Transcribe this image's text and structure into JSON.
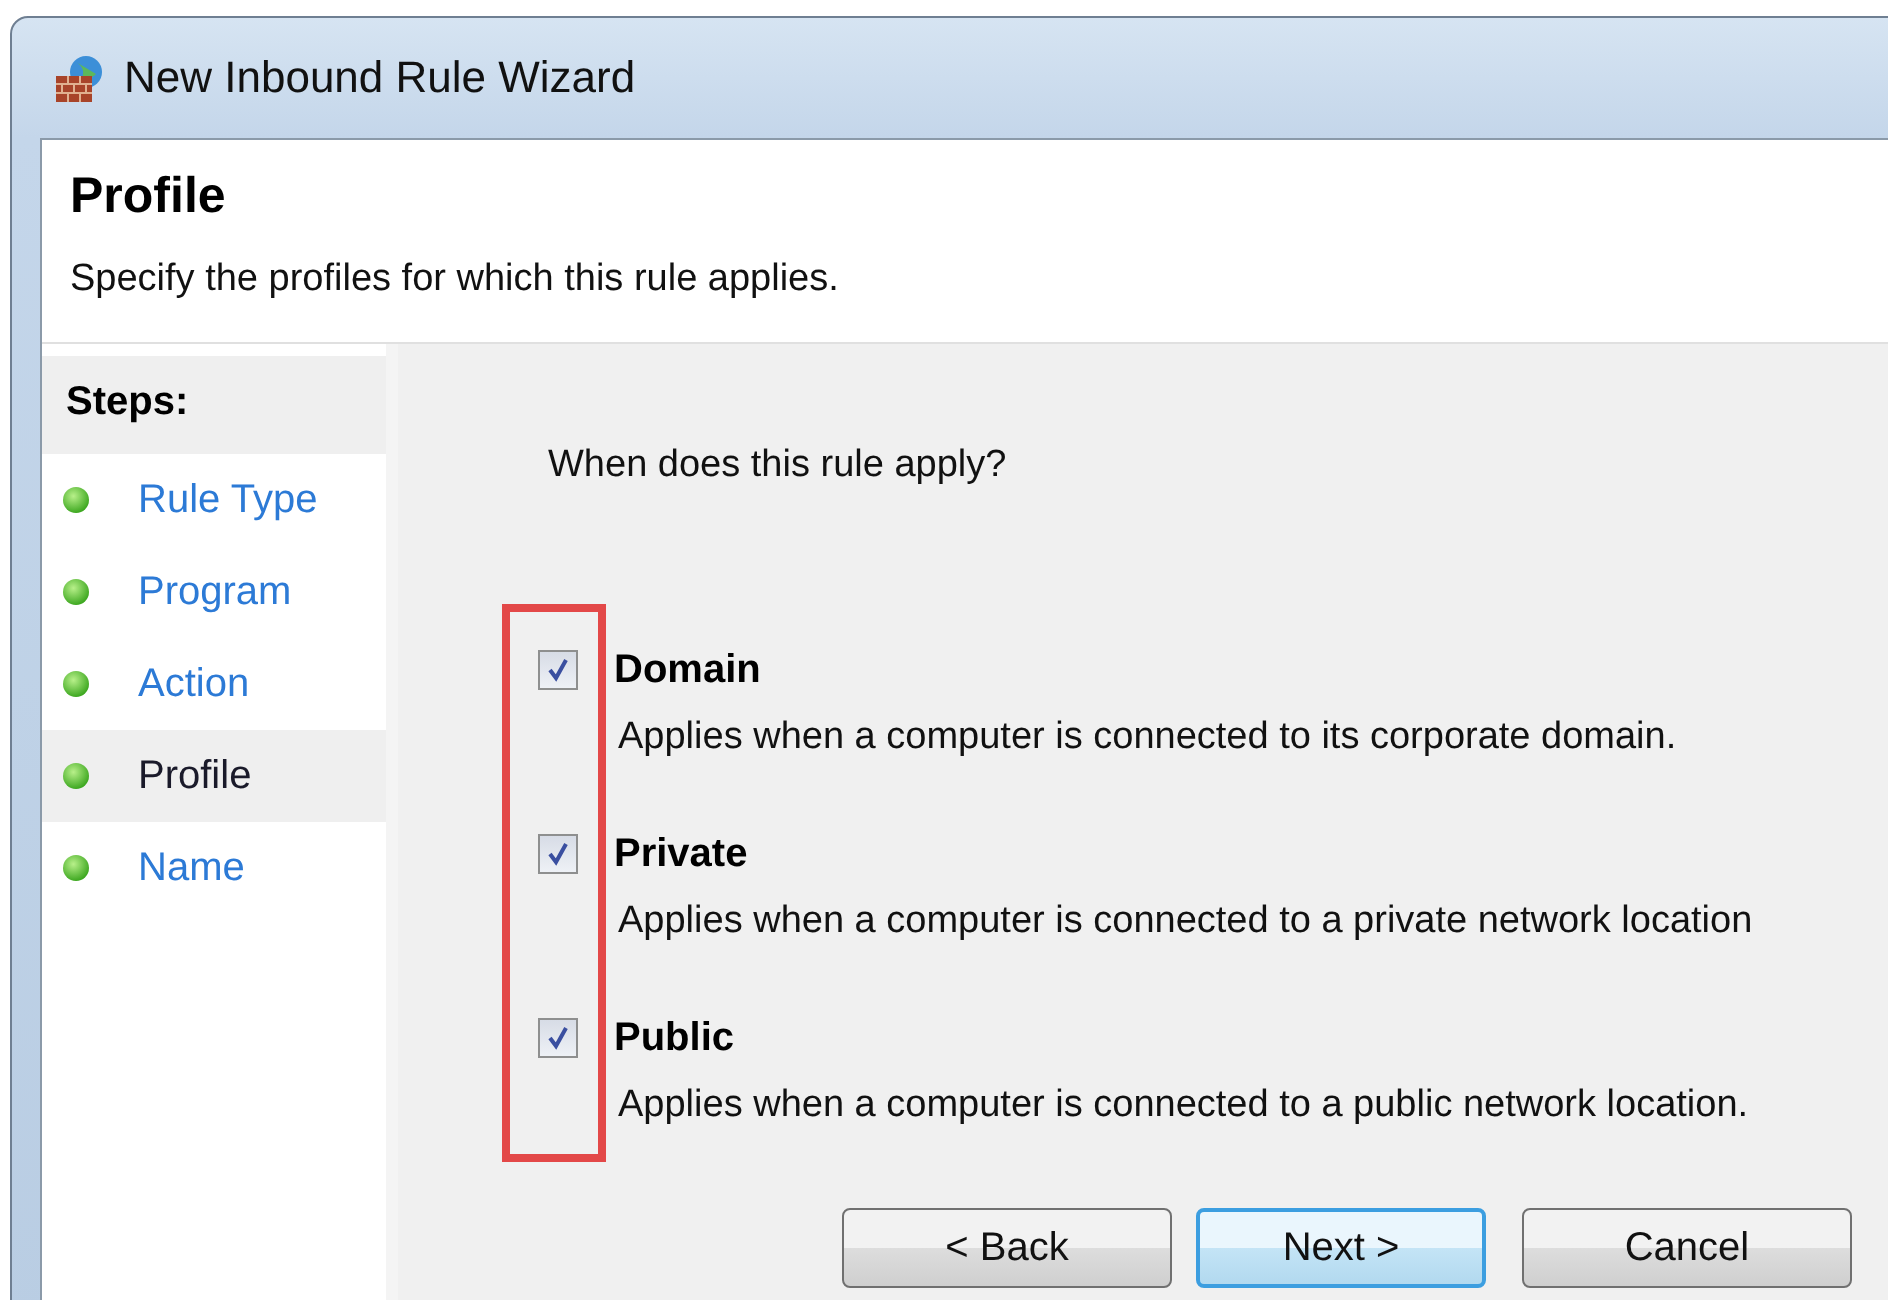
{
  "window": {
    "title": "New Inbound Rule Wizard"
  },
  "header": {
    "title": "Profile",
    "subtitle": "Specify the profiles for which this rule applies."
  },
  "steps": {
    "heading": "Steps:",
    "items": [
      {
        "label": "Rule Type",
        "selected": false
      },
      {
        "label": "Program",
        "selected": false
      },
      {
        "label": "Action",
        "selected": false
      },
      {
        "label": "Profile",
        "selected": true
      },
      {
        "label": "Name",
        "selected": false
      }
    ]
  },
  "question": "When does this rule apply?",
  "profiles": [
    {
      "label": "Domain",
      "checked": true,
      "description": "Applies when a computer is connected to its corporate domain."
    },
    {
      "label": "Private",
      "checked": true,
      "description": "Applies when a computer is connected to a private network location"
    },
    {
      "label": "Public",
      "checked": true,
      "description": "Applies when a computer is connected to a public network location."
    }
  ],
  "buttons": [
    {
      "label": "< Back",
      "kind": "normal"
    },
    {
      "label": "Next >",
      "kind": "default"
    },
    {
      "label": "Cancel",
      "kind": "normal"
    }
  ]
}
